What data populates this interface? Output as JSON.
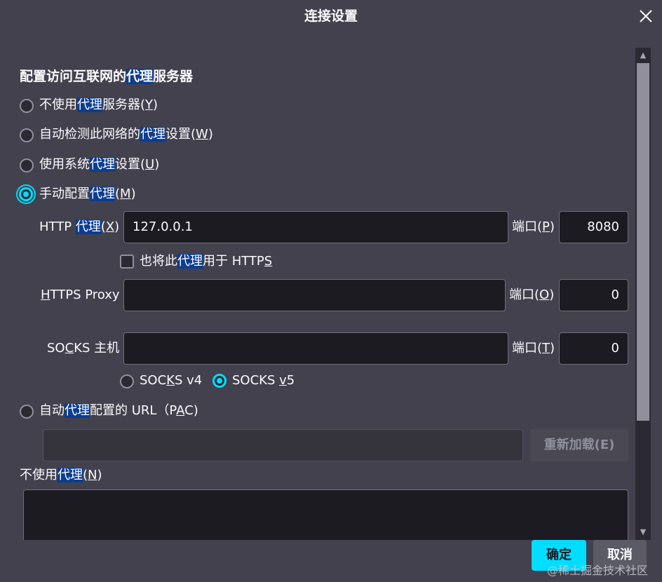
{
  "dialog": {
    "title": "连接设置",
    "close_icon": "close-icon"
  },
  "section": {
    "title_pre": "配置访问互联网的",
    "title_hl": "代理",
    "title_post": "服务器"
  },
  "options": {
    "no_proxy": {
      "pre": "不使用",
      "hl": "代理",
      "post": "服务器(",
      "key": "Y",
      "end": ")",
      "checked": false
    },
    "auto_detect": {
      "pre": "自动检测此网络的",
      "hl": "代理",
      "post": "设置(",
      "key": "W",
      "end": ")",
      "checked": false
    },
    "system": {
      "pre": "使用系统",
      "hl": "代理",
      "post": "设置(",
      "key": "U",
      "end": ")",
      "checked": false
    },
    "manual": {
      "pre": "手动配置",
      "hl": "代理",
      "post": "(",
      "key": "M",
      "end": ")",
      "checked": true
    },
    "pac": {
      "pre": "自动",
      "hl": "代理",
      "post": "配置的 URL（P",
      "key": "A",
      "end": "C)",
      "checked": false
    }
  },
  "http": {
    "label_pre": "HTTP ",
    "label_hl": "代理",
    "label_post": "(",
    "label_key": "X",
    "label_end": ")",
    "value": "127.0.0.1",
    "port_label_pre": "端口(",
    "port_label_key": "P",
    "port_label_end": ")",
    "port": "8080"
  },
  "also_https": {
    "pre": "也将此",
    "hl": "代理",
    "post": "用于 HTTP",
    "key": "S",
    "checked": false
  },
  "https": {
    "label_key": "H",
    "label_rest": "TTPS Proxy",
    "value": "",
    "port_label_pre": "端口(",
    "port_label_key": "O",
    "port_label_end": ")",
    "port": "0"
  },
  "socks": {
    "label_pre": "SO",
    "label_key": "C",
    "label_post": "KS 主机",
    "value": "",
    "port_label_pre": "端口(",
    "port_label_key": "T",
    "port_label_end": ")",
    "port": "0",
    "v4_pre": "SOC",
    "v4_key": "K",
    "v4_post": "S v4",
    "v5_pre": "SOCKS ",
    "v5_key": "v",
    "v5_post": "5",
    "v4_checked": false,
    "v5_checked": true
  },
  "pac_url": {
    "value": "",
    "reload_label": "重新加载(E)"
  },
  "no_proxy_for": {
    "pre": "不使用",
    "hl": "代理",
    "post": "(",
    "key": "N",
    "end": ")",
    "value": ""
  },
  "buttons": {
    "ok": "确定",
    "cancel": "取消"
  },
  "watermark": "@稀土掘金技术社区",
  "colors": {
    "background": "#42414d",
    "accent": "#00ddff",
    "highlight": "#0b3d91",
    "input_bg": "#1c1b22"
  }
}
